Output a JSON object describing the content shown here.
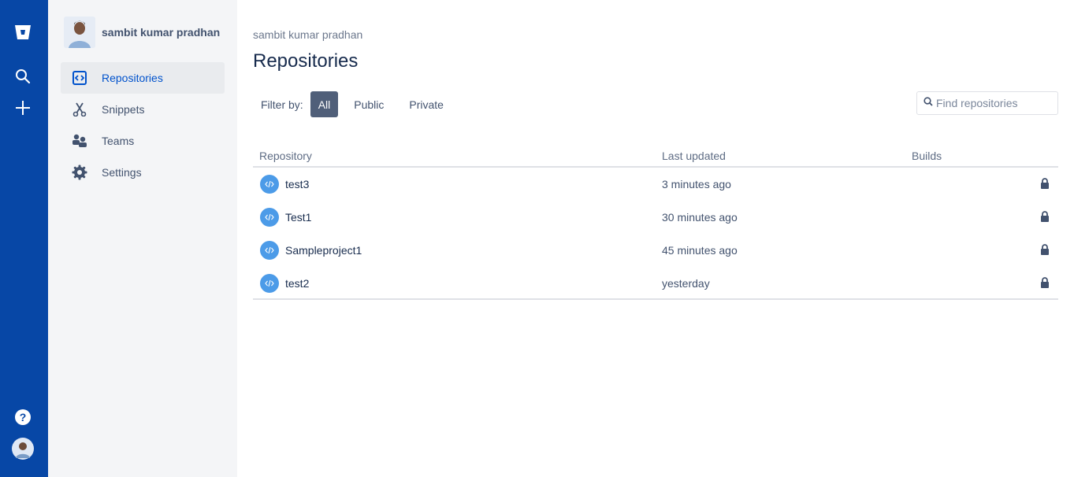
{
  "app": {
    "brand_icon": "bitbucket-logo-icon"
  },
  "global_nav": {
    "items": [
      {
        "name": "search-icon"
      },
      {
        "name": "create-icon"
      }
    ],
    "bottom": [
      {
        "name": "help-icon"
      },
      {
        "name": "user-avatar"
      }
    ]
  },
  "sidebar": {
    "profile_name": "sambit kumar pradhan",
    "items": [
      {
        "label": "Repositories",
        "icon": "repositories-icon",
        "active": true
      },
      {
        "label": "Snippets",
        "icon": "snippets-icon",
        "active": false
      },
      {
        "label": "Teams",
        "icon": "teams-icon",
        "active": false
      },
      {
        "label": "Settings",
        "icon": "gear-icon",
        "active": false
      }
    ]
  },
  "main": {
    "breadcrumb": "sambit kumar pradhan",
    "title": "Repositories",
    "filter": {
      "label": "Filter by:",
      "options": [
        "All",
        "Public",
        "Private"
      ],
      "selected": "All"
    },
    "search": {
      "placeholder": "Find repositories",
      "value": ""
    },
    "table": {
      "headers": [
        "Repository",
        "Last updated",
        "Builds"
      ],
      "rows": [
        {
          "name": "test3",
          "updated": "3 minutes ago",
          "private": true
        },
        {
          "name": "Test1",
          "updated": "30 minutes ago",
          "private": true
        },
        {
          "name": "Sampleproject1",
          "updated": "45 minutes ago",
          "private": true
        },
        {
          "name": "test2",
          "updated": "yesterday",
          "private": true
        }
      ]
    }
  },
  "colors": {
    "global_nav_bg": "#0747a6",
    "sidebar_bg": "#f4f5f7",
    "active_link": "#0052cc",
    "selected_filter_bg": "#505f79",
    "repo_icon_bg": "#4c9be8"
  }
}
